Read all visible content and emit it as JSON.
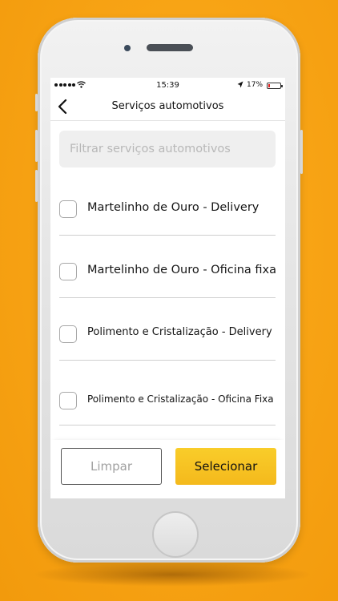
{
  "status_bar": {
    "time": "15:39",
    "battery_percent": "17%",
    "battery_level": 0.17,
    "battery_color": "#e02020",
    "signal_dots": 5,
    "wifi_icon": "wifi-icon",
    "location_icon": "location-arrow-icon"
  },
  "nav": {
    "back_icon": "chevron-left-icon",
    "title": "Serviços automotivos"
  },
  "filter": {
    "placeholder": "Filtrar serviços automotivos",
    "value": ""
  },
  "services": [
    {
      "label": "Martelinho de Ouro - Delivery",
      "checked": false
    },
    {
      "label": "Martelinho de Ouro - Oficina fixa",
      "checked": false
    },
    {
      "label": "Polimento e Cristalização - Delivery",
      "checked": false
    },
    {
      "label": "Polimento e Cristalização - Oficina Fixa",
      "checked": false
    }
  ],
  "actions": {
    "clear_label": "Limpar",
    "select_label": "Selecionar"
  },
  "colors": {
    "background_orange": "#f8a415",
    "accent_yellow": "#f6c021",
    "clear_text": "#a0a0a0"
  }
}
